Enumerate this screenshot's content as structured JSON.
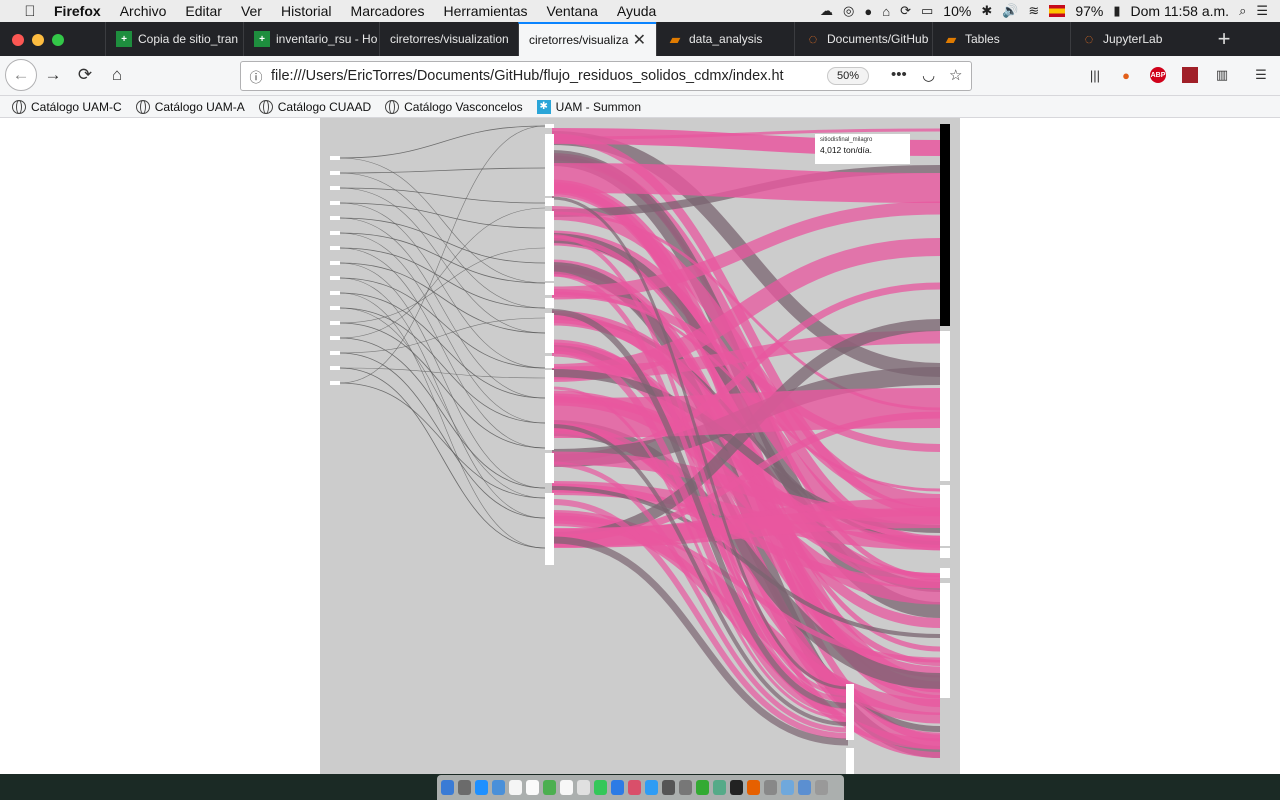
{
  "menubar": {
    "items": [
      "Firefox",
      "Archivo",
      "Editar",
      "Ver",
      "Historial",
      "Marcadores",
      "Herramientas",
      "Ventana",
      "Ayuda"
    ],
    "status_cpu": "10%",
    "status_battery": "97%",
    "status_time": "Dom 11:58 a.m."
  },
  "tabs": [
    {
      "title": "Copia de sitio_tran",
      "icon": "sheets-icon",
      "color": "#1e8e3e"
    },
    {
      "title": "inventario_rsu - Ho",
      "icon": "sheets-icon",
      "color": "#1e8e3e"
    },
    {
      "title": "ciretorres/visualization",
      "icon": "none",
      "color": ""
    },
    {
      "title": "ciretorres/visualiza",
      "icon": "none",
      "color": ""
    },
    {
      "title": "data_analysis",
      "icon": "book-icon",
      "color": "#e07b00"
    },
    {
      "title": "Documents/GitHub",
      "icon": "jupyter-icon",
      "color": "#f37626"
    },
    {
      "title": "Tables",
      "icon": "book-icon",
      "color": "#e07b00"
    },
    {
      "title": "JupyterLab",
      "icon": "jupyter-icon",
      "color": "#f37626"
    }
  ],
  "active_tab": 3,
  "nav": {
    "url": "file:///Users/EricTorres/Documents/GitHub/flujo_residuos_solidos_cdmx/index.ht",
    "zoom": "50%"
  },
  "bookmarks": [
    {
      "label": "Catálogo UAM-C",
      "icon": "globe-icon"
    },
    {
      "label": "Catálogo UAM-A",
      "icon": "globe-icon"
    },
    {
      "label": "Catálogo CUAAD",
      "icon": "globe-icon"
    },
    {
      "label": "Catálogo Vasconcelos",
      "icon": "globe-icon"
    },
    {
      "label": "UAM - Summon",
      "icon": "summon-icon"
    }
  ],
  "viz": {
    "background": "#cccccc",
    "link_pink": "#e8579f",
    "link_gray": "#7a6470",
    "tooltip": {
      "name": "sitiodisfinal_milagro",
      "value": "4,012 ton/día."
    }
  }
}
